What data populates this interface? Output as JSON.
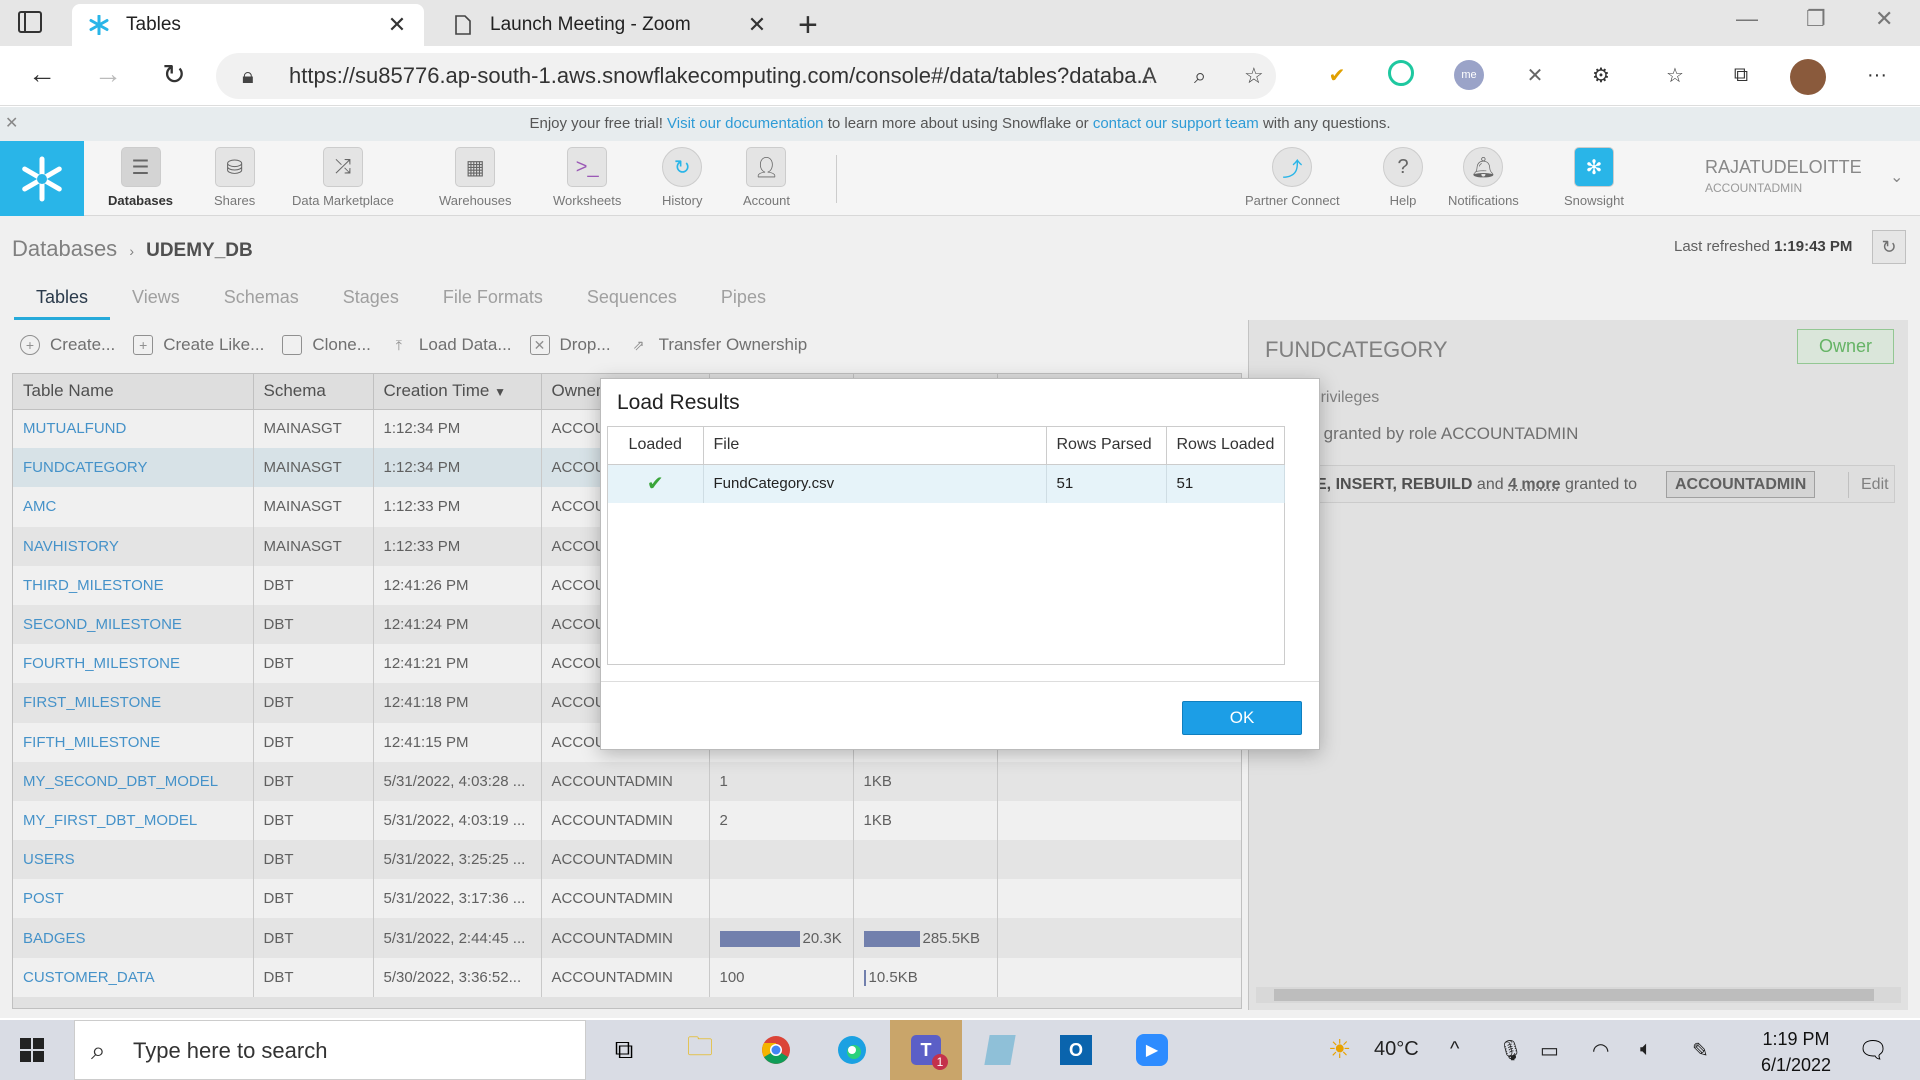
{
  "browser": {
    "tabs": [
      {
        "label": "Tables",
        "icon": "snowflake-icon"
      },
      {
        "label": "Launch Meeting - Zoom",
        "icon": "document-icon"
      }
    ],
    "url": "https://su85776.ap-south-1.aws.snowflakecomputing.com/console#/data/tables?databa..."
  },
  "trial_banner": {
    "prefix": "Enjoy your free trial!",
    "link1": "Visit our documentation",
    "middle": "to learn more about using Snowflake or",
    "link2": "contact our support team",
    "suffix": "with any questions."
  },
  "header": {
    "nav": [
      {
        "label": "Databases",
        "icon": "database-icon",
        "selected": true
      },
      {
        "label": "Shares",
        "icon": "shares-icon"
      },
      {
        "label": "Data Marketplace",
        "icon": "marketplace-icon"
      },
      {
        "label": "Warehouses",
        "icon": "warehouse-icon"
      },
      {
        "label": "Worksheets",
        "icon": "worksheet-icon"
      },
      {
        "label": "History",
        "icon": "history-icon"
      },
      {
        "label": "Account",
        "icon": "account-icon"
      }
    ],
    "right_nav": [
      {
        "label": "Partner Connect",
        "icon": "partner-connect-icon"
      },
      {
        "label": "Help",
        "icon": "help-icon"
      },
      {
        "label": "Notifications",
        "icon": "bell-icon"
      },
      {
        "label": "Snowsight",
        "icon": "snowsight-icon"
      }
    ],
    "user": {
      "name": "RAJATUDELOITTE",
      "role": "ACCOUNTADMIN"
    }
  },
  "breadcrumb": {
    "root": "Databases",
    "db": "UDEMY_DB"
  },
  "last_refreshed": {
    "label": "Last refreshed",
    "time": "1:19:43 PM"
  },
  "subtabs": [
    "Tables",
    "Views",
    "Schemas",
    "Stages",
    "File Formats",
    "Sequences",
    "Pipes"
  ],
  "toolbar": [
    "Create...",
    "Create Like...",
    "Clone...",
    "Load Data...",
    "Drop...",
    "Transfer Ownership"
  ],
  "table": {
    "columns": [
      "Table Name",
      "Schema",
      "Creation Time",
      "Owner",
      "",
      ""
    ],
    "rows": [
      {
        "name": "MUTUALFUND",
        "schema": "MAINASGT",
        "time": "1:12:34 PM",
        "owner": "ACCOU",
        "rows": "",
        "size": ""
      },
      {
        "name": "FUNDCATEGORY",
        "schema": "MAINASGT",
        "time": "1:12:34 PM",
        "owner": "ACCOU",
        "rows": "",
        "size": ""
      },
      {
        "name": "AMC",
        "schema": "MAINASGT",
        "time": "1:12:33 PM",
        "owner": "ACCOU",
        "rows": "",
        "size": ""
      },
      {
        "name": "NAVHISTORY",
        "schema": "MAINASGT",
        "time": "1:12:33 PM",
        "owner": "ACCOU",
        "rows": "",
        "size": ""
      },
      {
        "name": "THIRD_MILESTONE",
        "schema": "DBT",
        "time": "12:41:26 PM",
        "owner": "ACCOU",
        "rows": "",
        "size": ""
      },
      {
        "name": "SECOND_MILESTONE",
        "schema": "DBT",
        "time": "12:41:24 PM",
        "owner": "ACCOU",
        "rows": "",
        "size": ""
      },
      {
        "name": "FOURTH_MILESTONE",
        "schema": "DBT",
        "time": "12:41:21 PM",
        "owner": "ACCOU",
        "rows": "",
        "size": ""
      },
      {
        "name": "FIRST_MILESTONE",
        "schema": "DBT",
        "time": "12:41:18 PM",
        "owner": "ACCOU",
        "rows": "",
        "size": ""
      },
      {
        "name": "FIFTH_MILESTONE",
        "schema": "DBT",
        "time": "12:41:15 PM",
        "owner": "ACCOU",
        "rows": "",
        "size": ""
      },
      {
        "name": "MY_SECOND_DBT_MODEL",
        "schema": "DBT",
        "time": "5/31/2022, 4:03:28 ...",
        "owner": "ACCOUNTADMIN",
        "rows": "1",
        "size": "1KB"
      },
      {
        "name": "MY_FIRST_DBT_MODEL",
        "schema": "DBT",
        "time": "5/31/2022, 4:03:19 ...",
        "owner": "ACCOUNTADMIN",
        "rows": "2",
        "size": "1KB"
      },
      {
        "name": "USERS",
        "schema": "DBT",
        "time": "5/31/2022, 3:25:25 ...",
        "owner": "ACCOUNTADMIN",
        "rows": "",
        "size": ""
      },
      {
        "name": "POST",
        "schema": "DBT",
        "time": "5/31/2022, 3:17:36 ...",
        "owner": "ACCOUNTADMIN",
        "rows": "",
        "size": ""
      },
      {
        "name": "BADGES",
        "schema": "DBT",
        "time": "5/31/2022, 2:44:45 ...",
        "owner": "ACCOUNTADMIN",
        "rows": "20.3K",
        "size": "285.5KB",
        "rows_bar": 1.0,
        "size_bar": 1.0
      },
      {
        "name": "CUSTOMER_DATA",
        "schema": "DBT",
        "time": "5/30/2022, 3:36:52...",
        "owner": "ACCOUNTADMIN",
        "rows": "100",
        "size": "10.5KB",
        "size_bar": 0.03
      }
    ]
  },
  "right_panel": {
    "title": "FUNDCATEGORY",
    "owner_badge": "Owner",
    "privileges_label": "t Privileges",
    "granted_text": "es granted by role ACCOUNTADMIN",
    "grant_row": {
      "privs": "E, INSERT, REBUILD",
      "and": "and",
      "more": "4 more",
      "granted_to": "granted to",
      "role": "ACCOUNTADMIN",
      "edit": "Edit"
    }
  },
  "modal": {
    "title": "Load Results",
    "columns": [
      "Loaded",
      "File",
      "Rows Parsed",
      "Rows Loaded"
    ],
    "rows": [
      {
        "loaded": "✔",
        "file": "FundCategory.csv",
        "parsed": "51",
        "loaded_rows": "51"
      }
    ],
    "ok": "OK"
  },
  "taskbar": {
    "search_placeholder": "Type here to search",
    "weather": "40°C",
    "time": "1:19 PM",
    "date": "6/1/2022",
    "teams_badge": "1"
  },
  "colors": {
    "snowflake_blue": "#29b5e8",
    "link": "#4a9cd6",
    "ok_button": "#1c9ee6"
  }
}
